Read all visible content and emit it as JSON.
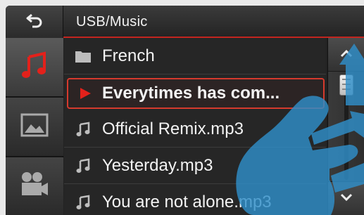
{
  "header": {
    "back_icon": "back-arrow-icon",
    "path": "USB/Music"
  },
  "sidebar": {
    "tabs": [
      {
        "icon": "music-note-icon",
        "active": true
      },
      {
        "icon": "picture-icon",
        "active": false
      },
      {
        "icon": "video-camera-icon",
        "active": false
      }
    ]
  },
  "list": {
    "items": [
      {
        "type": "folder",
        "icon": "folder-icon",
        "label": "French"
      },
      {
        "type": "playing",
        "icon": "play-icon",
        "label": "Everytimes has com..."
      },
      {
        "type": "track",
        "icon": "music-note-icon",
        "label": "Official Remix.mp3"
      },
      {
        "type": "track",
        "icon": "music-note-icon",
        "label": "Yesterday.mp3"
      },
      {
        "type": "track",
        "icon": "music-note-icon",
        "label": "You are not alone.mp3"
      }
    ]
  },
  "scrollbar": {
    "up_icon": "chevron-up-icon",
    "down_icon": "chevron-down-icon"
  },
  "colors": {
    "accent": "#d63a2d",
    "overlay_blue": "#2f8fc9"
  }
}
